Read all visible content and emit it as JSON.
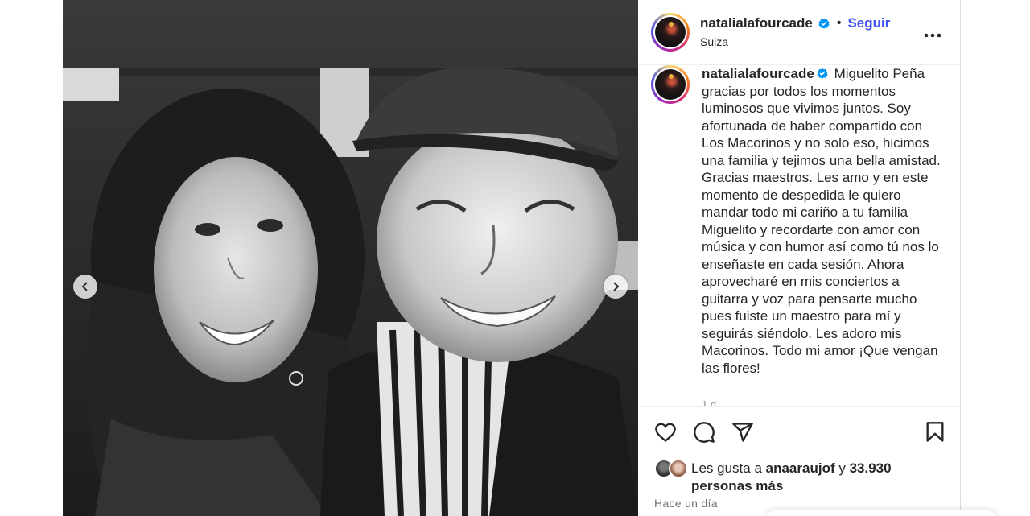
{
  "post": {
    "username": "natalialafourcade",
    "follow_label": "Seguir",
    "separator": "•",
    "location": "Suiza",
    "more_label": "•••",
    "caption_text": "Miguelito Peña gracias por todos los momentos luminosos que vivimos juntos. Soy afortunada de haber compartido con Los Macorinos y no solo eso, hicimos una familia y tejimos una bella amistad. Gracias maestros. Les amo y en este momento de despedida le quiero mandar todo mi cariño a tu familia Miguelito y recordarte con amor con música y con humor así como tú nos lo enseñaste en cada sesión. Ahora aprovecharé en mis conciertos a guitarra y voz para pensarte mucho pues fuiste un maestro para mí y seguirás siéndolo. Les adoro mis Macorinos. Todo mi amor ¡Que vengan las flores!",
    "caption_time_partial": "1 d",
    "likes_prefix": "Les gusta a",
    "likes_user": "anaaraujof",
    "likes_conjunction": "y",
    "likes_count": "33.930",
    "likes_suffix": "personas más",
    "timestamp": "Hace un día"
  },
  "icons": {
    "verified": "verified-badge-icon",
    "like": "heart-icon",
    "comment": "comment-icon",
    "share": "paper-plane-icon",
    "save": "bookmark-icon",
    "prev": "chevron-left-icon",
    "next": "chevron-right-icon"
  },
  "colors": {
    "follow": "#4153f3",
    "verified": "#0095f6",
    "text": "#262626",
    "muted": "#737373"
  }
}
